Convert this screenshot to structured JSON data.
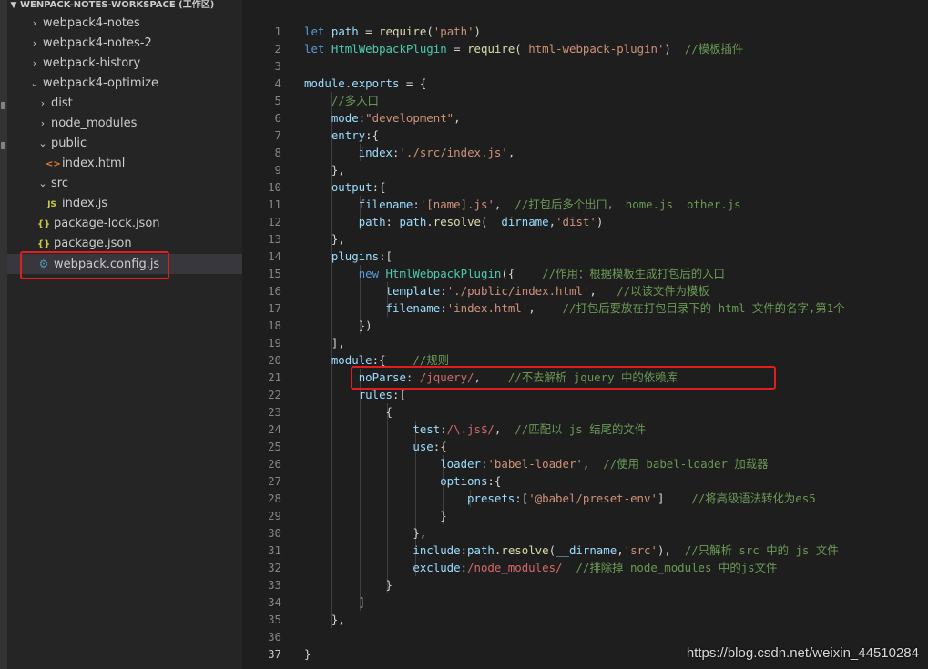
{
  "explorer": {
    "workspace_title": "WENPACK-NOTES-WORKSPACE (工作区)",
    "items": [
      {
        "label": "webpack4-notes",
        "kind": "folder",
        "expanded": false
      },
      {
        "label": "webpack4-notes-2",
        "kind": "folder",
        "expanded": false
      },
      {
        "label": "webpack-history",
        "kind": "folder",
        "expanded": false
      },
      {
        "label": "webpack4-optimize",
        "kind": "folder",
        "expanded": true
      },
      {
        "label": "dist",
        "kind": "folder",
        "expanded": false
      },
      {
        "label": "node_modules",
        "kind": "folder",
        "expanded": false
      },
      {
        "label": "public",
        "kind": "folder",
        "expanded": true
      },
      {
        "label": "index.html",
        "kind": "html",
        "icon": "html-file-icon"
      },
      {
        "label": "src",
        "kind": "folder",
        "expanded": true
      },
      {
        "label": "index.js",
        "kind": "js",
        "icon": "js-file-icon"
      },
      {
        "label": "package-lock.json",
        "kind": "json",
        "icon": "json-file-icon"
      },
      {
        "label": "package.json",
        "kind": "json",
        "icon": "json-file-icon"
      },
      {
        "label": "webpack.config.js",
        "kind": "config",
        "icon": "webpack-config-icon",
        "selected": true
      }
    ]
  },
  "editor": {
    "active_line": 37,
    "lines": [
      {
        "n": "1",
        "t": [
          [
            "kw",
            "let"
          ],
          [
            "pn",
            " "
          ],
          [
            "id",
            "path"
          ],
          [
            "pn",
            " = "
          ],
          [
            "fn",
            "require"
          ],
          [
            "pn",
            "("
          ],
          [
            "str",
            "'path'"
          ],
          [
            "pn",
            ")"
          ]
        ]
      },
      {
        "n": "2",
        "t": [
          [
            "kw",
            "let"
          ],
          [
            "pn",
            " "
          ],
          [
            "cls",
            "HtmlWebpackPlugin"
          ],
          [
            "pn",
            " = "
          ],
          [
            "fn",
            "require"
          ],
          [
            "pn",
            "("
          ],
          [
            "str",
            "'html-webpack-plugin'"
          ],
          [
            "pn",
            ")  "
          ],
          [
            "cm",
            "//模板插件"
          ]
        ]
      },
      {
        "n": "3",
        "t": []
      },
      {
        "n": "4",
        "t": [
          [
            "id",
            "module"
          ],
          [
            "pn",
            "."
          ],
          [
            "id",
            "exports"
          ],
          [
            "pn",
            " = {"
          ]
        ]
      },
      {
        "n": "5",
        "t": [
          [
            "pn",
            "    "
          ],
          [
            "cm",
            "//多入口"
          ]
        ]
      },
      {
        "n": "6",
        "t": [
          [
            "pn",
            "    "
          ],
          [
            "id",
            "mode"
          ],
          [
            "pn",
            ":"
          ],
          [
            "str",
            "\"development\""
          ],
          [
            "pn",
            ","
          ]
        ]
      },
      {
        "n": "7",
        "t": [
          [
            "pn",
            "    "
          ],
          [
            "id",
            "entry"
          ],
          [
            "pn",
            ":{"
          ]
        ]
      },
      {
        "n": "8",
        "t": [
          [
            "pn",
            "        "
          ],
          [
            "id",
            "index"
          ],
          [
            "pn",
            ":"
          ],
          [
            "str",
            "'./src/index.js'"
          ],
          [
            "pn",
            ","
          ]
        ]
      },
      {
        "n": "9",
        "t": [
          [
            "pn",
            "    },"
          ]
        ]
      },
      {
        "n": "10",
        "t": [
          [
            "pn",
            "    "
          ],
          [
            "id",
            "output"
          ],
          [
            "pn",
            ":{"
          ]
        ]
      },
      {
        "n": "11",
        "t": [
          [
            "pn",
            "        "
          ],
          [
            "id",
            "filename"
          ],
          [
            "pn",
            ":"
          ],
          [
            "str",
            "'[name].js'"
          ],
          [
            "pn",
            ",  "
          ],
          [
            "cm",
            "//打包后多个出口， home.js  other.js"
          ]
        ]
      },
      {
        "n": "12",
        "t": [
          [
            "pn",
            "        "
          ],
          [
            "id",
            "path"
          ],
          [
            "pn",
            ": "
          ],
          [
            "id",
            "path"
          ],
          [
            "pn",
            "."
          ],
          [
            "fn",
            "resolve"
          ],
          [
            "pn",
            "("
          ],
          [
            "id",
            "__dirname"
          ],
          [
            "pn",
            ","
          ],
          [
            "str",
            "'dist'"
          ],
          [
            "pn",
            ")"
          ]
        ]
      },
      {
        "n": "13",
        "t": [
          [
            "pn",
            "    },"
          ]
        ]
      },
      {
        "n": "14",
        "t": [
          [
            "pn",
            "    "
          ],
          [
            "id",
            "plugins"
          ],
          [
            "pn",
            ":["
          ]
        ]
      },
      {
        "n": "15",
        "t": [
          [
            "pn",
            "        "
          ],
          [
            "kw",
            "new"
          ],
          [
            "pn",
            " "
          ],
          [
            "cls",
            "HtmlWebpackPlugin"
          ],
          [
            "pn",
            "({    "
          ],
          [
            "cm",
            "//作用：根据模板生成打包后的入口"
          ]
        ]
      },
      {
        "n": "16",
        "t": [
          [
            "pn",
            "            "
          ],
          [
            "id",
            "template"
          ],
          [
            "pn",
            ":"
          ],
          [
            "str",
            "'./public/index.html'"
          ],
          [
            "pn",
            ",   "
          ],
          [
            "cm",
            "//以该文件为模板"
          ]
        ]
      },
      {
        "n": "17",
        "t": [
          [
            "pn",
            "            "
          ],
          [
            "id",
            "filename"
          ],
          [
            "pn",
            ":"
          ],
          [
            "str",
            "'index.html'"
          ],
          [
            "pn",
            ",    "
          ],
          [
            "cm",
            "//打包后要放在打包目录下的 html 文件的名字,第1个"
          ]
        ]
      },
      {
        "n": "18",
        "t": [
          [
            "pn",
            "        })"
          ]
        ]
      },
      {
        "n": "19",
        "t": [
          [
            "pn",
            "    ],"
          ]
        ]
      },
      {
        "n": "20",
        "t": [
          [
            "pn",
            "    "
          ],
          [
            "id",
            "module"
          ],
          [
            "pn",
            ":{    "
          ],
          [
            "cm",
            "//规则"
          ]
        ]
      },
      {
        "n": "21",
        "t": [
          [
            "pn",
            "        "
          ],
          [
            "id",
            "noParse"
          ],
          [
            "pn",
            ": "
          ],
          [
            "rx",
            "/jquery/"
          ],
          [
            "pn",
            ",    "
          ],
          [
            "cm",
            "//不去解析 jquery 中的依赖库"
          ]
        ]
      },
      {
        "n": "22",
        "t": [
          [
            "pn",
            "        "
          ],
          [
            "id",
            "rules"
          ],
          [
            "pn",
            ":["
          ]
        ]
      },
      {
        "n": "23",
        "t": [
          [
            "pn",
            "            {"
          ]
        ]
      },
      {
        "n": "24",
        "t": [
          [
            "pn",
            "                "
          ],
          [
            "id",
            "test"
          ],
          [
            "pn",
            ":"
          ],
          [
            "rx",
            "/\\.js$/"
          ],
          [
            "pn",
            ",  "
          ],
          [
            "cm",
            "//匹配以 js 结尾的文件"
          ]
        ]
      },
      {
        "n": "25",
        "t": [
          [
            "pn",
            "                "
          ],
          [
            "id",
            "use"
          ],
          [
            "pn",
            ":{"
          ]
        ]
      },
      {
        "n": "26",
        "t": [
          [
            "pn",
            "                    "
          ],
          [
            "id",
            "loader"
          ],
          [
            "pn",
            ":"
          ],
          [
            "str",
            "'babel-loader'"
          ],
          [
            "pn",
            ",  "
          ],
          [
            "cm",
            "//使用 babel-loader 加载器"
          ]
        ]
      },
      {
        "n": "27",
        "t": [
          [
            "pn",
            "                    "
          ],
          [
            "id",
            "options"
          ],
          [
            "pn",
            ":{"
          ]
        ]
      },
      {
        "n": "28",
        "t": [
          [
            "pn",
            "                        "
          ],
          [
            "id",
            "presets"
          ],
          [
            "pn",
            ":["
          ],
          [
            "str",
            "'@babel/preset-env'"
          ],
          [
            "pn",
            "]    "
          ],
          [
            "cm",
            "//将高级语法转化为es5"
          ]
        ]
      },
      {
        "n": "29",
        "t": [
          [
            "pn",
            "                    }"
          ]
        ]
      },
      {
        "n": "30",
        "t": [
          [
            "pn",
            "                },"
          ]
        ]
      },
      {
        "n": "31",
        "t": [
          [
            "pn",
            "                "
          ],
          [
            "id",
            "include"
          ],
          [
            "pn",
            ":"
          ],
          [
            "id",
            "path"
          ],
          [
            "pn",
            "."
          ],
          [
            "fn",
            "resolve"
          ],
          [
            "pn",
            "("
          ],
          [
            "id",
            "__dirname"
          ],
          [
            "pn",
            ","
          ],
          [
            "str",
            "'src'"
          ],
          [
            "pn",
            "),  "
          ],
          [
            "cm",
            "//只解析 src 中的 js 文件"
          ]
        ]
      },
      {
        "n": "32",
        "t": [
          [
            "pn",
            "                "
          ],
          [
            "id",
            "exclude"
          ],
          [
            "pn",
            ":"
          ],
          [
            "rx",
            "/node_modules/"
          ],
          [
            "pn",
            "  "
          ],
          [
            "cm",
            "//排除掉 node_modules 中的js文件"
          ]
        ]
      },
      {
        "n": "33",
        "t": [
          [
            "pn",
            "            }"
          ]
        ]
      },
      {
        "n": "34",
        "t": [
          [
            "pn",
            "        ]"
          ]
        ]
      },
      {
        "n": "35",
        "t": [
          [
            "pn",
            "    },"
          ]
        ]
      },
      {
        "n": "36",
        "t": []
      },
      {
        "n": "37",
        "t": [
          [
            "pn",
            "}"
          ]
        ]
      }
    ]
  },
  "watermark": "https://blog.csdn.net/weixin_44510284",
  "highlight_color": "#e01e1e"
}
